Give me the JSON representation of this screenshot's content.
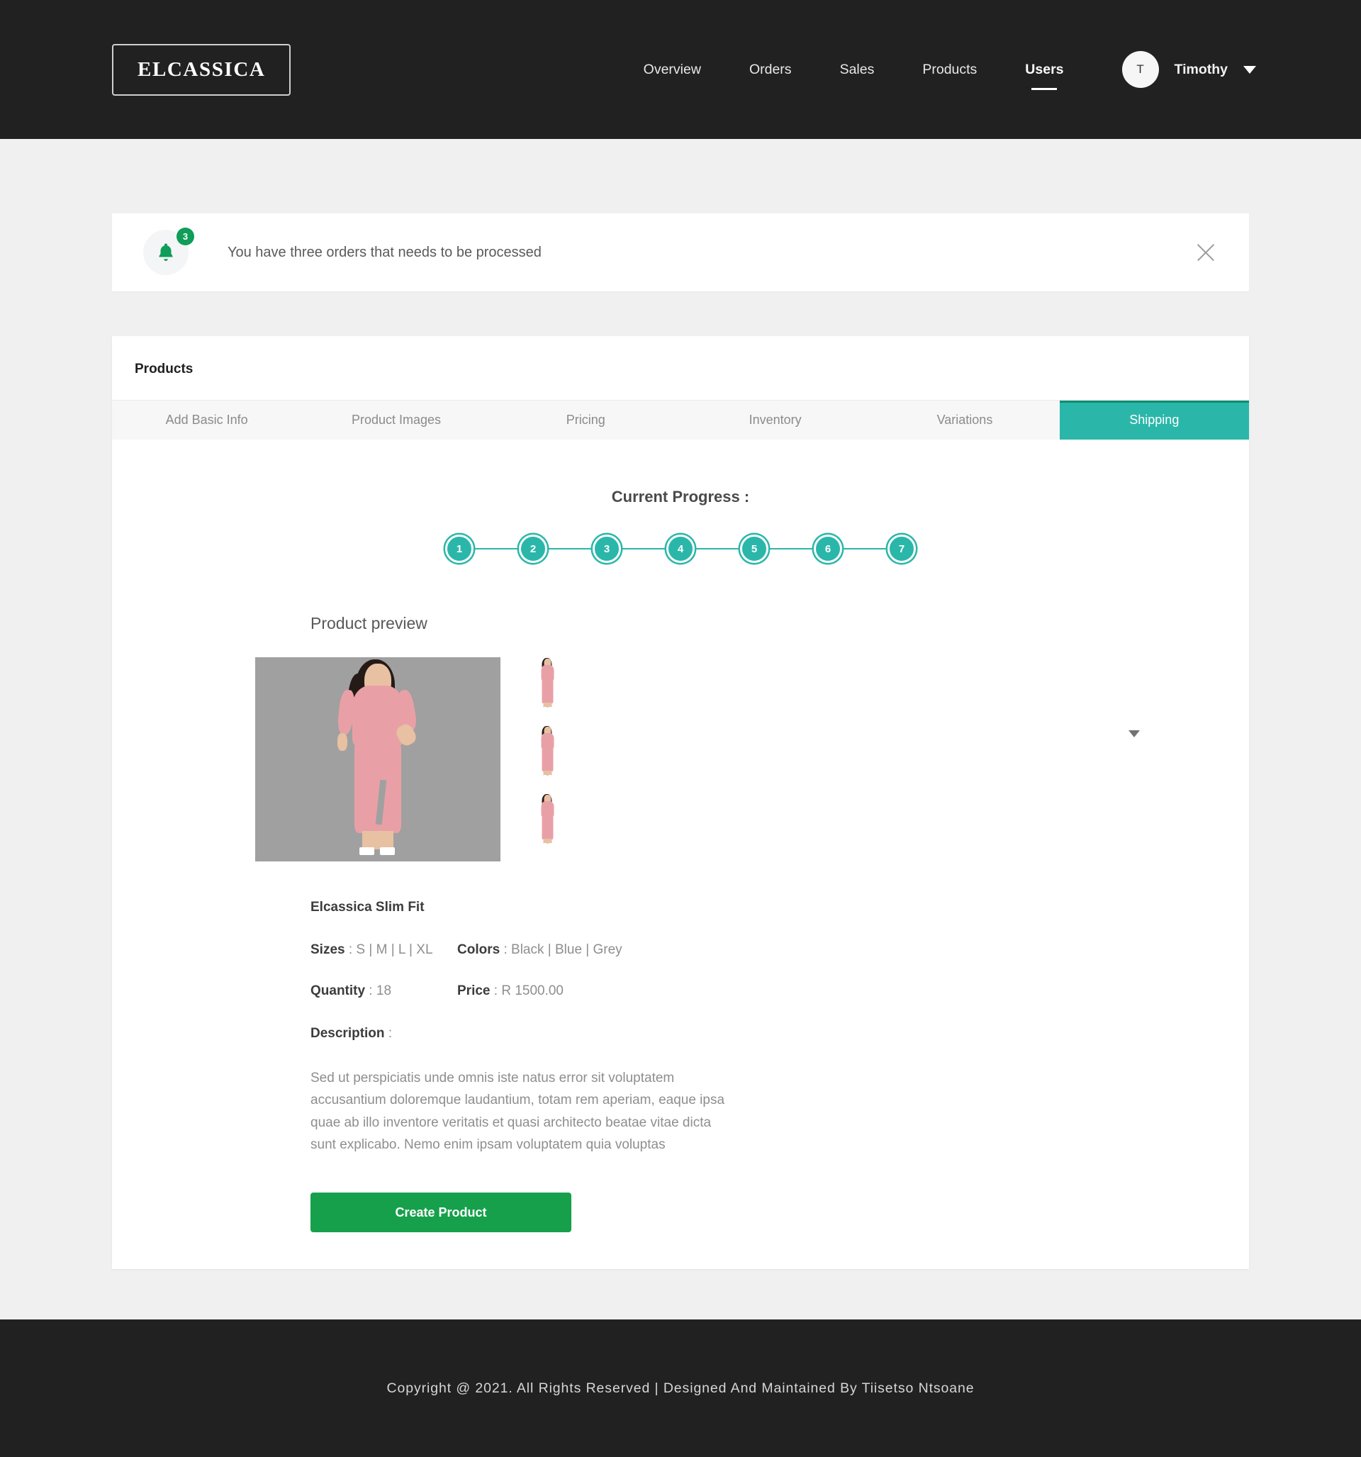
{
  "header": {
    "logo": "ELCASSICA",
    "nav": [
      {
        "label": "Overview",
        "active": false
      },
      {
        "label": "Orders",
        "active": false
      },
      {
        "label": "Sales",
        "active": false
      },
      {
        "label": "Products",
        "active": false
      },
      {
        "label": "Users",
        "active": true
      }
    ],
    "user": {
      "avatar_initial": "T",
      "name": "Timothy",
      "caret_icon": "chevron-down-icon"
    }
  },
  "notification": {
    "icon": "bell-icon",
    "badge_count": "3",
    "message": "You have three orders that needs to be processed",
    "close_icon": "close-icon"
  },
  "products_card": {
    "title": "Products",
    "tabs": [
      {
        "label": "Add Basic Info",
        "active": false
      },
      {
        "label": "Product Images",
        "active": false
      },
      {
        "label": "Pricing",
        "active": false
      },
      {
        "label": "Inventory",
        "active": false
      },
      {
        "label": "Variations",
        "active": false
      },
      {
        "label": "Shipping",
        "active": true
      }
    ],
    "progress": {
      "title": "Current Progress :",
      "steps": [
        "1",
        "2",
        "3",
        "4",
        "5",
        "6",
        "7"
      ]
    },
    "preview": {
      "title": "Product preview",
      "main_image_alt": "pink-slim-fit-dress-front",
      "thumbnails": [
        "pink-dress-thumb-1",
        "pink-dress-thumb-2",
        "pink-dress-thumb-3"
      ]
    },
    "details": {
      "product_name": "Elcassica Slim Fit",
      "sizes_label": "Sizes",
      "sizes_value": ": S | M | L | XL",
      "colors_label": "Colors",
      "colors_value": ": Black | Blue | Grey",
      "quantity_label": "Quantity",
      "quantity_value": ": 18",
      "price_label": "Price",
      "price_value": ": R 1500.00",
      "description_label": "Description",
      "description_colon": ":",
      "description_body": "Sed ut perspiciatis unde omnis iste natus error sit voluptatem accusantium doloremque laudantium, totam rem aperiam, eaque ipsa quae ab illo inventore veritatis et quasi architecto beatae vitae dicta sunt explicabo. Nemo enim ipsam voluptatem quia voluptas"
    },
    "create_button": "Create Product",
    "side_caret_icon": "chevron-down-icon"
  },
  "footer": {
    "text": "Copyright @ 2021. All Rights Reserved | Designed And Maintained By Tiisetso Ntsoane"
  },
  "colors": {
    "header_bg": "#212121",
    "page_bg": "#f0f0f0",
    "accent_teal": "#2ab7a9",
    "accent_teal_border": "#0e8d72",
    "green": "#17a04b",
    "badge_green": "#0f9d58"
  }
}
